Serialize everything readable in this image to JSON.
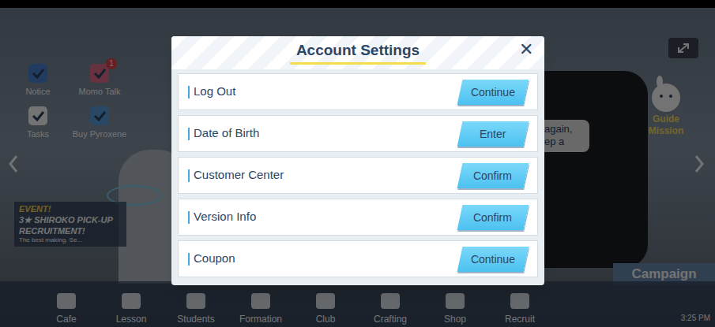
{
  "modal": {
    "title": "Account Settings",
    "close": "✕",
    "rows": [
      {
        "label": "Log Out",
        "button": "Continue"
      },
      {
        "label": "Date of Birth",
        "button": "Enter"
      },
      {
        "label": "Customer Center",
        "button": "Confirm"
      },
      {
        "label": "Version Info",
        "button": "Confirm"
      },
      {
        "label": "Coupon",
        "button": "Continue"
      }
    ]
  },
  "hud": {
    "menu": [
      {
        "label": "Notice"
      },
      {
        "label": "Momo Talk",
        "badge": "1"
      },
      {
        "label": "Tasks"
      },
      {
        "label": "Buy Pyroxene"
      }
    ],
    "event_banner": {
      "tag": "EVENT!",
      "title": "3★ SHIROKO PICK-UP RECRUITMENT!",
      "subtitle": "The best making. Se..."
    },
    "guide_mission": "Guide Mission",
    "speech": [
      "again,",
      "ep a"
    ],
    "campaign": "Campaign",
    "nav": [
      "Cafe",
      "Lesson",
      "Students",
      "Formation",
      "Club",
      "Crafting",
      "Shop",
      "Recruit"
    ],
    "clock": "3:25 PM"
  }
}
